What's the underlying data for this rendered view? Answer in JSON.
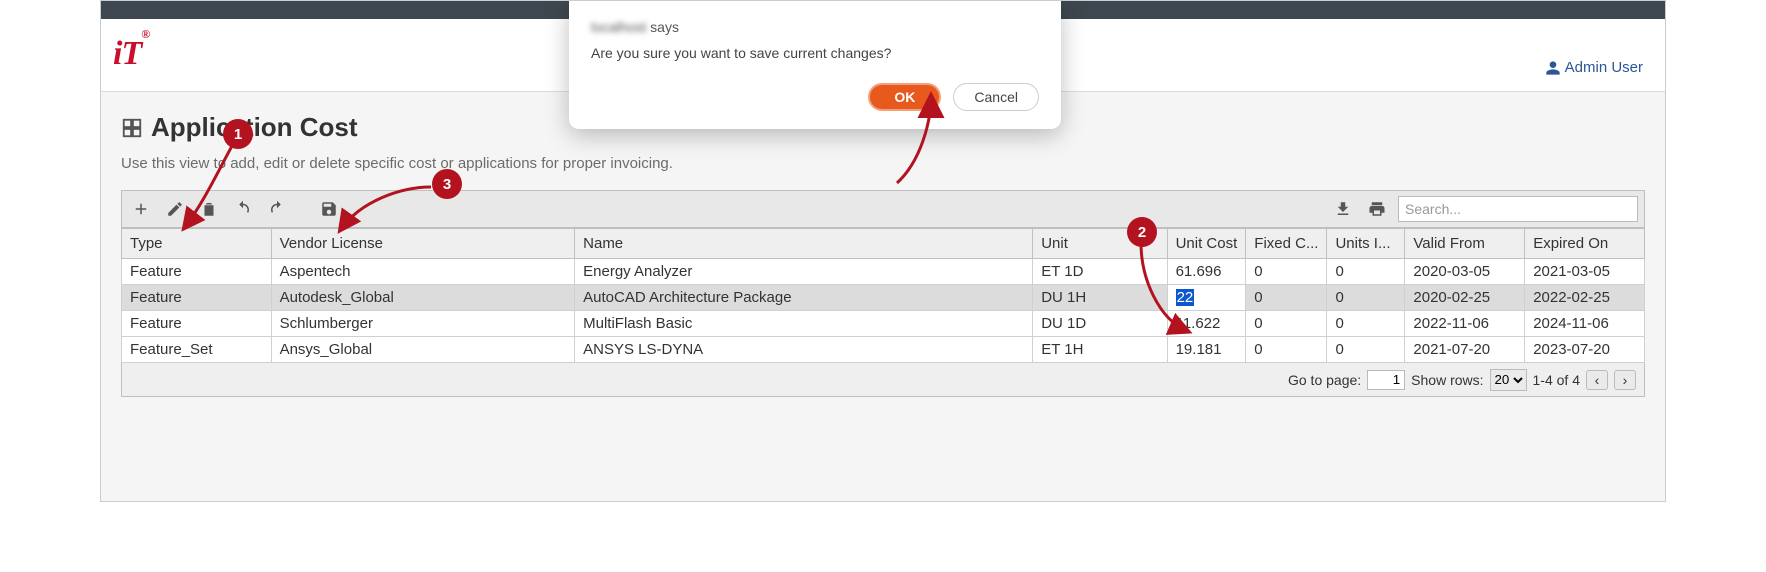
{
  "header": {
    "logo_text": "iT",
    "user_label": "Admin User"
  },
  "page": {
    "title": "Application Cost",
    "description": "Use this view to add, edit or delete specific cost or applications for proper invoicing."
  },
  "toolbar": {
    "search_placeholder": "Search..."
  },
  "table": {
    "columns": {
      "type": "Type",
      "vendor": "Vendor License",
      "name": "Name",
      "unit": "Unit",
      "unit_cost": "Unit Cost",
      "fixed_cost": "Fixed C...",
      "units_i": "Units I...",
      "valid_from": "Valid From",
      "expired_on": "Expired On"
    },
    "rows": [
      {
        "type": "Feature",
        "vendor": "Aspentech",
        "name": "Energy Analyzer",
        "unit": "ET 1D",
        "unit_cost": "61.696",
        "fixed_cost": "0",
        "units_i": "0",
        "valid_from": "2020-03-05",
        "expired_on": "2021-03-05",
        "selected": false,
        "editing": false
      },
      {
        "type": "Feature",
        "vendor": "Autodesk_Global",
        "name": "AutoCAD Architecture Package",
        "unit": "DU 1H",
        "unit_cost": "22",
        "fixed_cost": "0",
        "units_i": "0",
        "valid_from": "2020-02-25",
        "expired_on": "2022-02-25",
        "selected": true,
        "editing": true
      },
      {
        "type": "Feature",
        "vendor": "Schlumberger",
        "name": "MultiFlash Basic",
        "unit": "DU 1D",
        "unit_cost": "11.622",
        "fixed_cost": "0",
        "units_i": "0",
        "valid_from": "2022-11-06",
        "expired_on": "2024-11-06",
        "selected": false,
        "editing": false
      },
      {
        "type": "Feature_Set",
        "vendor": "Ansys_Global",
        "name": "ANSYS LS-DYNA",
        "unit": "ET 1H",
        "unit_cost": "19.181",
        "fixed_cost": "0",
        "units_i": "0",
        "valid_from": "2021-07-20",
        "expired_on": "2023-07-20",
        "selected": false,
        "editing": false
      }
    ]
  },
  "pagination": {
    "goto_label": "Go to page:",
    "page_value": "1",
    "showrows_label": "Show rows:",
    "rows_value": "20",
    "range_label": "1-4 of 4"
  },
  "dialog": {
    "origin_blurred": "localhost",
    "origin_says": " says",
    "message": "Are you sure you want to save current changes?",
    "ok_label": "OK",
    "cancel_label": "Cancel"
  },
  "annotations": {
    "n1": "1",
    "n2": "2",
    "n3": "3"
  }
}
